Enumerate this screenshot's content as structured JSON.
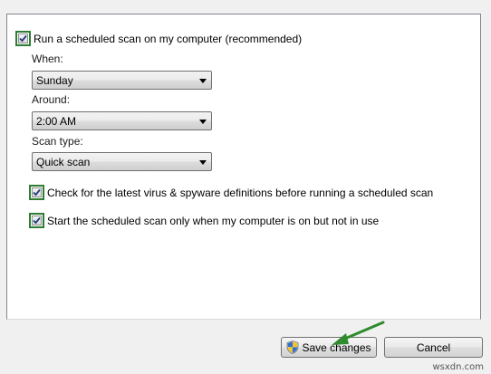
{
  "scheduled_scan": {
    "run_label": "Run a scheduled scan on my computer (recommended)",
    "run_checked": true,
    "when_label": "When:",
    "when_value": "Sunday",
    "around_label": "Around:",
    "around_value": "2:00 AM",
    "scan_type_label": "Scan type:",
    "scan_type_value": "Quick scan",
    "check_definitions_label": "Check for the latest virus & spyware definitions before running a scheduled scan",
    "check_definitions_checked": true,
    "idle_only_label": "Start the scheduled scan only when my computer is on but not in use",
    "idle_only_checked": true
  },
  "buttons": {
    "save_label": "Save changes",
    "cancel_label": "Cancel"
  },
  "icons": {
    "checkbox": "checkmark-icon",
    "dropdown": "chevron-down-icon",
    "uac": "uac-shield-icon",
    "annotation": "green-arrow-icon"
  },
  "colors": {
    "highlight": "#2e7d32",
    "arrow": "#2e8b2e"
  },
  "watermark": "wsxdn.com"
}
